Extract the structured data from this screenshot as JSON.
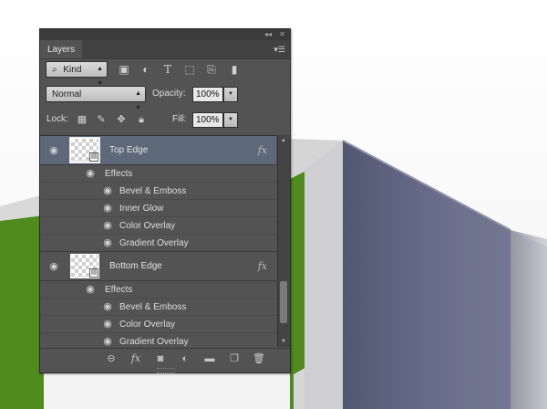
{
  "panel": {
    "tab_title": "Layers",
    "menu_icon": "panel-menu-icon",
    "filter": {
      "label": "Kind",
      "search_icon": "⌕"
    },
    "blend_mode": "Normal",
    "opacity_label": "Opacity:",
    "opacity_value": "100%",
    "lock_label": "Lock:",
    "fill_label": "Fill:",
    "fill_value": "100%",
    "layers": [
      {
        "name": "Top Edge",
        "selected": true,
        "fx": "fx",
        "effects_label": "Effects",
        "effects": [
          "Bevel & Emboss",
          "Inner Glow",
          "Color Overlay",
          "Gradient Overlay"
        ]
      },
      {
        "name": "Bottom Edge",
        "selected": false,
        "fx": "fx",
        "effects_label": "Effects",
        "effects": [
          "Bevel & Emboss",
          "Color Overlay",
          "Gradient Overlay"
        ]
      }
    ],
    "bottom_icons": [
      "link-icon",
      "fx-icon",
      "mask-icon",
      "adjustment-icon",
      "folder-icon",
      "new-layer-icon",
      "trash-icon"
    ],
    "bottom_fx": "fx"
  },
  "colors": {
    "panel_bg": "#535353",
    "selected_row": "#5d6878",
    "grass": "#4f8b1d",
    "wall": "#676d8c"
  }
}
